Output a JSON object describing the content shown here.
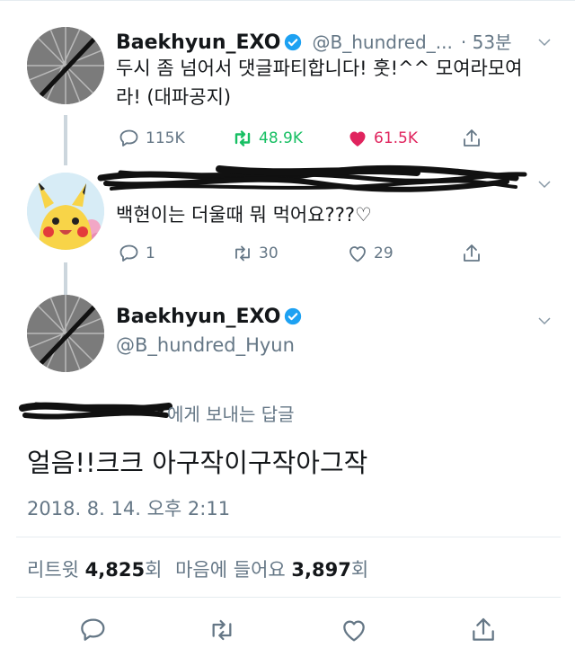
{
  "tweets": [
    {
      "author_name": "Baekhyun_EXO",
      "handle": "@B_hundred_...",
      "time": "· 53분",
      "text_line1": "두시 좀 넘어서 댓글파티합니다! 훗!^^ 모여라모여",
      "text_line2": "라! (대파공지)",
      "replies": "115K",
      "retweets": "48.9K",
      "likes": "61.5K"
    },
    {
      "text": "백현이는 더울때 뭐 먹어요???♡",
      "replies": "1",
      "retweets": "30",
      "likes": "29"
    }
  ],
  "focused": {
    "author_name": "Baekhyun_EXO",
    "handle": "@B_hundred_Hyun",
    "reply_to_suffix": "에게 보내는 답글",
    "text": "얼음!!크크 아구작이구작아그작",
    "timestamp": "2018. 8. 14. 오후 2:11",
    "retweets_label": "리트윗",
    "retweets_count": "4,825",
    "retweets_unit": "회",
    "likes_label": "마음에 들어요",
    "likes_count": "3,897",
    "likes_unit": "회"
  },
  "colors": {
    "retweet_active": "#17bf63",
    "like_active": "#e0245e",
    "verified": "#1da1f2",
    "muted": "#657786"
  },
  "icons": [
    "reply-icon",
    "retweet-icon",
    "like-icon",
    "share-icon",
    "verified-icon",
    "chevron-down-icon"
  ]
}
